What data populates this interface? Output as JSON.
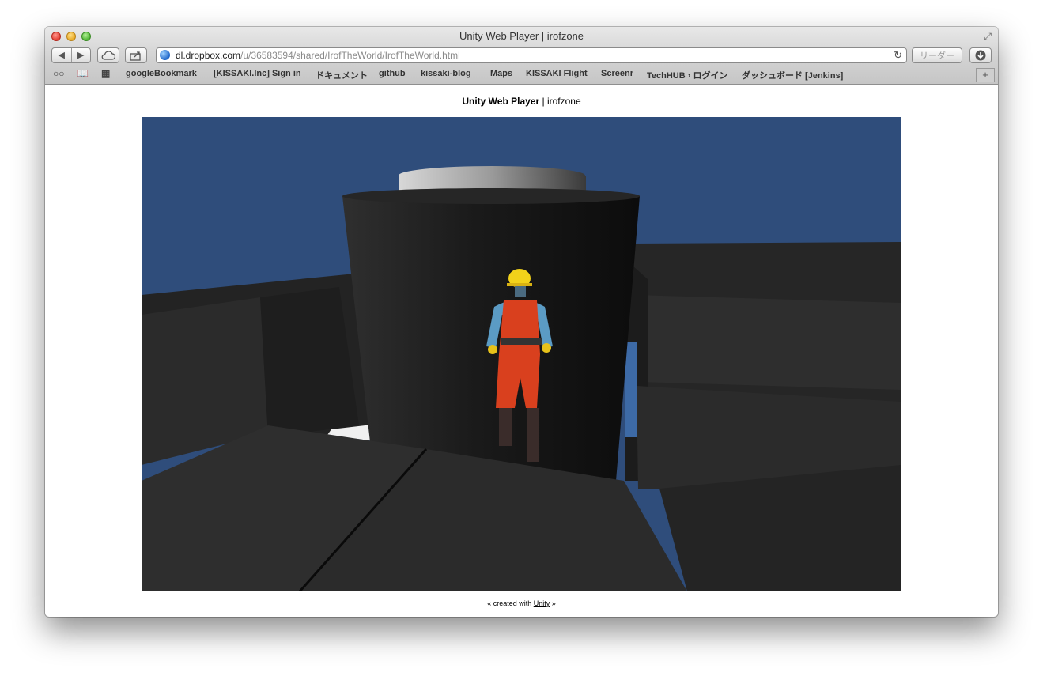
{
  "window": {
    "title": "Unity Web Player | irofzone"
  },
  "toolbar": {
    "back_icon": "◀",
    "forward_icon": "▶",
    "url_host": "dl.dropbox.com",
    "url_path": "/u/36583594/shared/IrofTheWorld/IrofTheWorld.html",
    "reader_label": "リーダー",
    "reload_icon": "↻"
  },
  "bookmarks": [
    "googleBookmark",
    "[KISSAKI.Inc] Sign in",
    "ドキュメント",
    "github",
    "kissaki-blog",
    "Maps",
    "KISSAKI Flight",
    "Screenr",
    "TechHUB › ログイン",
    "ダッシュボード [Jenkins]"
  ],
  "page": {
    "title_bold": "Unity Web Player",
    "title_rest": " | irofzone",
    "footer_before": "« created with ",
    "footer_link": "Unity",
    "footer_after": " »"
  },
  "colors": {
    "sky": "#2f4d7b",
    "building": "#262626",
    "overalls": "#d9401e",
    "helmet": "#f2d21a",
    "shirt": "#5b9bc4"
  }
}
